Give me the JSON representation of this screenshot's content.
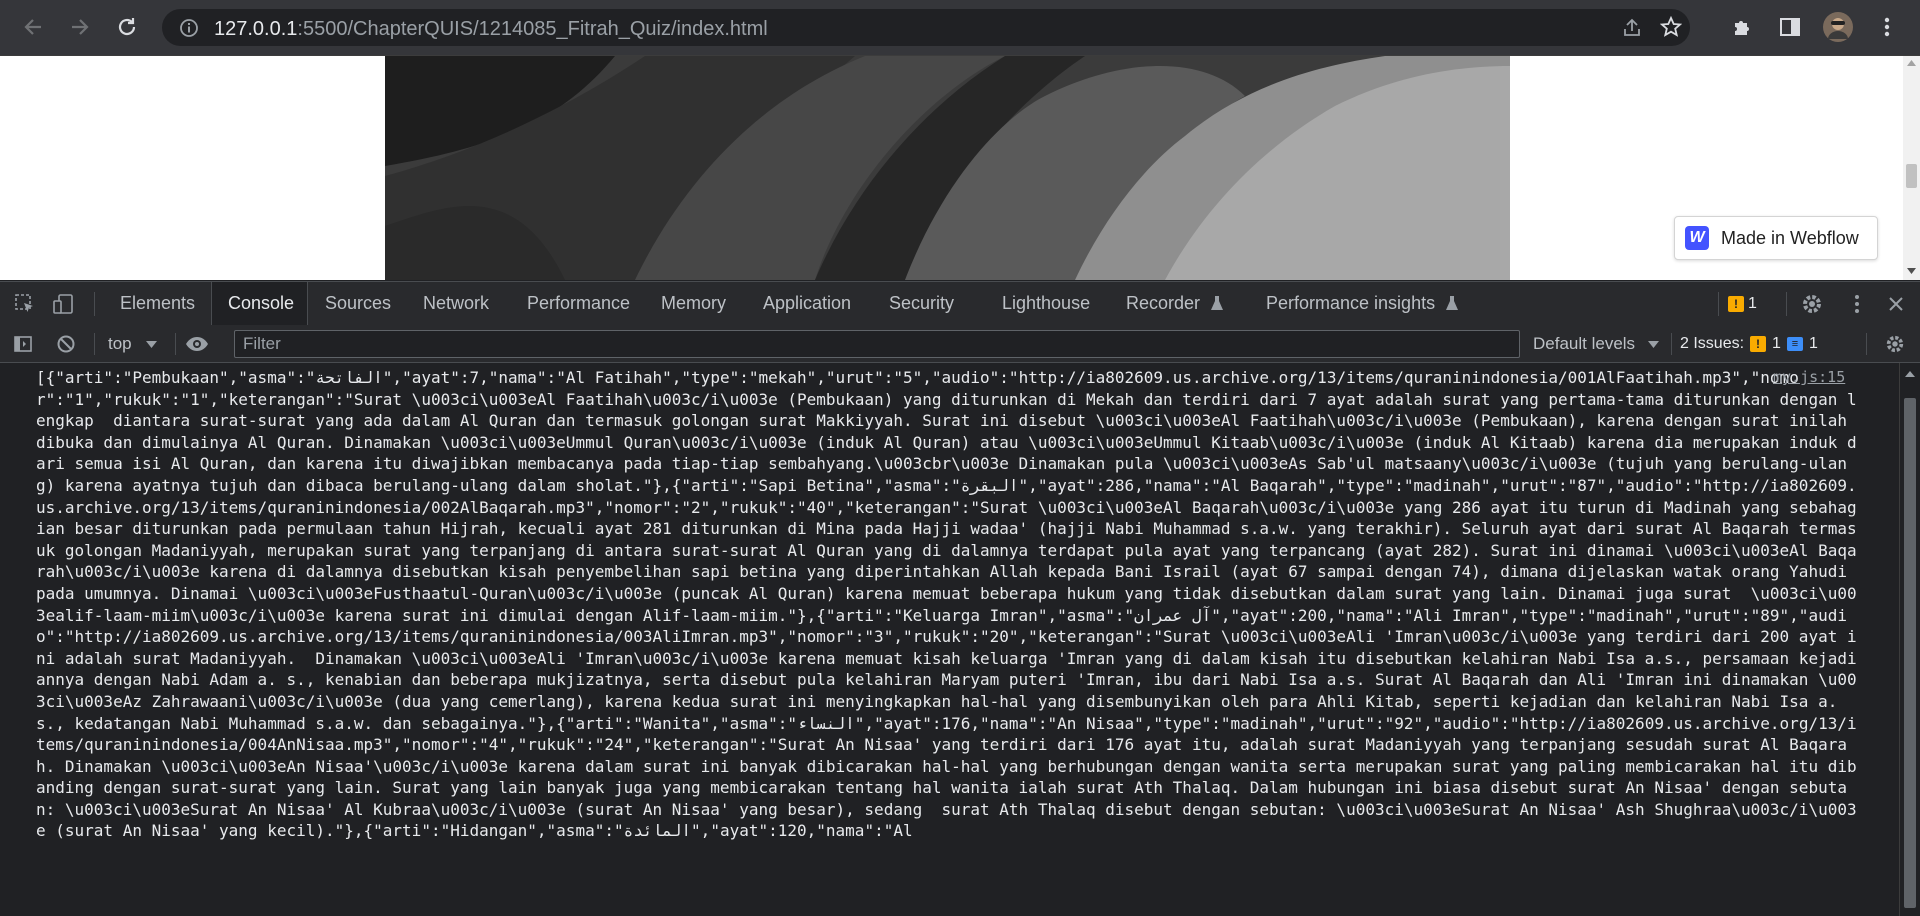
{
  "browser": {
    "url_host": "127.0.0.1",
    "url_path": ":5500/ChapterQUIS/1214085_Fitrah_Quiz/index.html"
  },
  "page": {
    "webflow_badge": "Made in Webflow",
    "webflow_logo_letter": "W"
  },
  "devtools": {
    "tabs": [
      "Elements",
      "Console",
      "Sources",
      "Network",
      "Performance",
      "Memory",
      "Application",
      "Security",
      "Lighthouse",
      "Recorder",
      "Performance insights"
    ],
    "active_tab": "Console",
    "warning_count": "1"
  },
  "console": {
    "context": "top",
    "filter_placeholder": "Filter",
    "levels": "Default levels",
    "issues_label": "2 Issues:",
    "issues_warn": "1",
    "issues_info": "1",
    "source": "my.js:15",
    "log": "[{\"arti\":\"Pembukaan\",\"asma\":\"الفاتحة\",\"ayat\":7,\"nama\":\"Al Fatihah\",\"type\":\"mekah\",\"urut\":\"5\",\"audio\":\"http://ia802609.us.archive.org/13/items/quraninindonesia/001AlFaatihah.mp3\",\"nomor\":\"1\",\"rukuk\":\"1\",\"keterangan\":\"Surat \\u003ci\\u003eAl Faatihah\\u003c/i\\u003e (Pembukaan) yang diturunkan di Mekah dan terdiri dari 7 ayat adalah surat yang pertama-tama diturunkan dengan lengkap  diantara surat-surat yang ada dalam Al Quran dan termasuk golongan surat Makkiyyah. Surat ini disebut \\u003ci\\u003eAl Faatihah\\u003c/i\\u003e (Pembukaan), karena dengan surat inilah dibuka dan dimulainya Al Quran. Dinamakan \\u003ci\\u003eUmmul Quran\\u003c/i\\u003e (induk Al Quran) atau \\u003ci\\u003eUmmul Kitaab\\u003c/i\\u003e (induk Al Kitaab) karena dia merupakan induk dari semua isi Al Quran, dan karena itu diwajibkan membacanya pada tiap-tiap sembahyang.\\u003cbr\\u003e Dinamakan pula \\u003ci\\u003eAs Sab'ul matsaany\\u003c/i\\u003e (tujuh yang berulang-ulang) karena ayatnya tujuh dan dibaca berulang-ulang dalam sholat.\"},{\"arti\":\"Sapi Betina\",\"asma\":\"البقرة\",\"ayat\":286,\"nama\":\"Al Baqarah\",\"type\":\"madinah\",\"urut\":\"87\",\"audio\":\"http://ia802609.us.archive.org/13/items/quraninindonesia/002AlBaqarah.mp3\",\"nomor\":\"2\",\"rukuk\":\"40\",\"keterangan\":\"Surat \\u003ci\\u003eAl Baqarah\\u003c/i\\u003e yang 286 ayat itu turun di Madinah yang sebahagian besar diturunkan pada permulaan tahun Hijrah, kecuali ayat 281 diturunkan di Mina pada Hajji wadaa' (hajji Nabi Muhammad s.a.w. yang terakhir). Seluruh ayat dari surat Al Baqarah termasuk golongan Madaniyyah, merupakan surat yang terpanjang di antara surat-surat Al Quran yang di dalamnya terdapat pula ayat yang terpancang (ayat 282). Surat ini dinamai \\u003ci\\u003eAl Baqarah\\u003c/i\\u003e karena di dalamnya disebutkan kisah penyembelihan sapi betina yang diperintahkan Allah kepada Bani Israil (ayat 67 sampai dengan 74), dimana dijelaskan watak orang Yahudi pada umumnya. Dinamai \\u003ci\\u003eFusthaatul-Quran\\u003c/i\\u003e (puncak Al Quran) karena memuat beberapa hukum yang tidak disebutkan dalam surat yang lain. Dinamai juga surat  \\u003ci\\u003ealif-laam-miim\\u003c/i\\u003e karena surat ini dimulai dengan Alif-laam-miim.\"},{\"arti\":\"Keluarga Imran\",\"asma\":\"آل عمران\",\"ayat\":200,\"nama\":\"Ali Imran\",\"type\":\"madinah\",\"urut\":\"89\",\"audio\":\"http://ia802609.us.archive.org/13/items/quraninindonesia/003AliImran.mp3\",\"nomor\":\"3\",\"rukuk\":\"20\",\"keterangan\":\"Surat \\u003ci\\u003eAli 'Imran\\u003c/i\\u003e yang terdiri dari 200 ayat ini adalah surat Madaniyyah.  Dinamakan \\u003ci\\u003eAli 'Imran\\u003c/i\\u003e karena memuat kisah keluarga 'Imran yang di dalam kisah itu disebutkan kelahiran Nabi Isa a.s., persamaan kejadiannya dengan Nabi Adam a. s., kenabian dan beberapa mukjizatnya, serta disebut pula kelahiran Maryam puteri 'Imran, ibu dari Nabi Isa a.s. Surat Al Baqarah dan Ali 'Imran ini dinamakan \\u003ci\\u003eAz Zahrawaani\\u003c/i\\u003e (dua yang cemerlang), karena kedua surat ini menyingkapkan hal-hal yang disembunyikan oleh para Ahli Kitab, seperti kejadian dan kelahiran Nabi Isa a.s., kedatangan Nabi Muhammad s.a.w. dan sebagainya.\"},{\"arti\":\"Wanita\",\"asma\":\"النساء\",\"ayat\":176,\"nama\":\"An Nisaa\",\"type\":\"madinah\",\"urut\":\"92\",\"audio\":\"http://ia802609.us.archive.org/13/items/quraninindonesia/004AnNisaa.mp3\",\"nomor\":\"4\",\"rukuk\":\"24\",\"keterangan\":\"Surat An Nisaa' yang terdiri dari 176 ayat itu, adalah surat Madaniyyah yang terpanjang sesudah surat Al Baqarah. Dinamakan \\u003ci\\u003eAn Nisaa'\\u003c/i\\u003e karena dalam surat ini banyak dibicarakan hal-hal yang berhubungan dengan wanita serta merupakan surat yang paling membicarakan hal itu dibanding dengan surat-surat yang lain. Surat yang lain banyak juga yang membicarakan tentang hal wanita ialah surat Ath Thalaq. Dalam hubungan ini biasa disebut surat An Nisaa' dengan sebutan: \\u003ci\\u003eSurat An Nisaa' Al Kubraa\\u003c/i\\u003e (surat An Nisaa' yang besar), sedang  surat Ath Thalaq disebut dengan sebutan: \\u003ci\\u003eSurat An Nisaa' Ash Shughraa\\u003c/i\\u003e (surat An Nisaa' yang kecil).\"},{\"arti\":\"Hidangan\",\"asma\":\"المائدة\",\"ayat\":120,\"nama\":\"Al"
  }
}
